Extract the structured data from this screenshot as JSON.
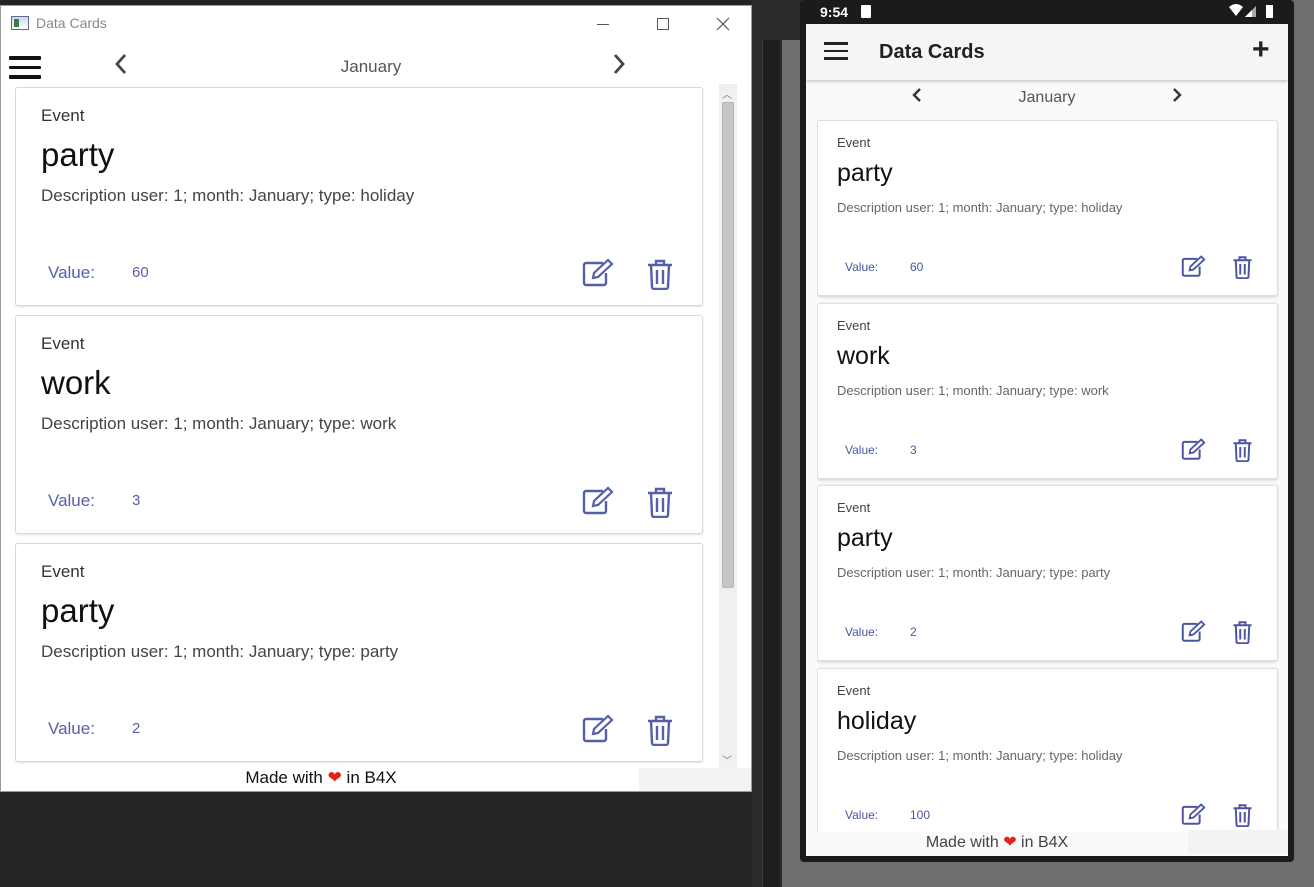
{
  "desktop": {
    "window_title": "Data Cards",
    "month": "January",
    "cards": [
      {
        "label": "Event",
        "title": "party",
        "description": "Description user: 1; month: January; type: holiday",
        "value_label": "Value:",
        "value": "60"
      },
      {
        "label": "Event",
        "title": "work",
        "description": "Description user: 1; month: January; type: work",
        "value_label": "Value:",
        "value": "3"
      },
      {
        "label": "Event",
        "title": "party",
        "description": "Description user: 1; month: January; type: party",
        "value_label": "Value:",
        "value": "2"
      }
    ],
    "footer": {
      "pre": "Made with",
      "heart": "❤",
      "post": "in B4X"
    }
  },
  "phone": {
    "status_time": "9:54",
    "app_title": "Data Cards",
    "add_icon": "+",
    "month": "January",
    "cards": [
      {
        "label": "Event",
        "title": "party",
        "description": "Description user: 1; month: January; type: holiday",
        "value_label": "Value:",
        "value": "60"
      },
      {
        "label": "Event",
        "title": "work",
        "description": "Description user: 1; month: January; type: work",
        "value_label": "Value:",
        "value": "3"
      },
      {
        "label": "Event",
        "title": "party",
        "description": "Description user: 1; month: January; type: party",
        "value_label": "Value:",
        "value": "2"
      },
      {
        "label": "Event",
        "title": "holiday",
        "description": "Description user: 1; month: January; type: holiday",
        "value_label": "Value:",
        "value": "100"
      }
    ],
    "footer": {
      "pre": "Made with",
      "heart": "❤",
      "post": "in B4X"
    }
  },
  "colors": {
    "accent": "#5560a8",
    "heart": "#e3221a"
  },
  "icons": {
    "edit": "edit-icon",
    "delete": "trash-icon",
    "menu": "hamburger-icon",
    "prev": "chevron-left-icon",
    "next": "chevron-right-icon"
  }
}
